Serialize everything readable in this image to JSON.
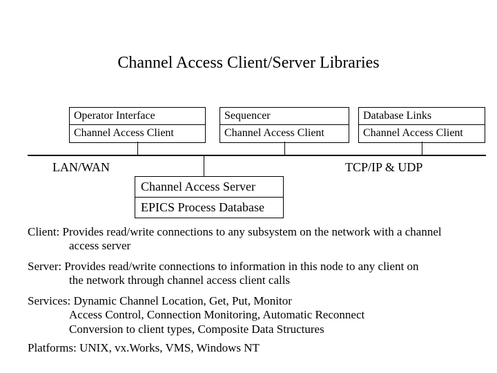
{
  "title": "Channel Access Client/Server Libraries",
  "columns": [
    {
      "top": "Operator Interface",
      "bottom": "Channel Access Client"
    },
    {
      "top": "Sequencer",
      "bottom": "Channel Access Client"
    },
    {
      "top": " Database Links",
      "bottom": "Channel Access Client"
    }
  ],
  "bus": {
    "left_label": "LAN/WAN",
    "right_label": "TCP/IP & UDP"
  },
  "server": {
    "top": "Channel Access Server",
    "bottom": "EPICS Process Database"
  },
  "paragraphs": {
    "client_label": "Client: ",
    "client_line1": "Provides read/write connections to any subsystem on the network with a channel",
    "client_line2": "access server",
    "server_label": "Server: ",
    "server_line1": "Provides read/write connections to information in this node to any client on",
    "server_line2": "the network through channel access client calls",
    "services_label": "Services: ",
    "services_line1": "Dynamic Channel Location, Get, Put, Monitor",
    "services_line2": "Access Control, Connection Monitoring, Automatic Reconnect",
    "services_line3": "Conversion to client types, Composite Data Structures",
    "platforms_label": "Platforms: ",
    "platforms_line1": "UNIX, vx.Works, VMS, Windows NT"
  }
}
